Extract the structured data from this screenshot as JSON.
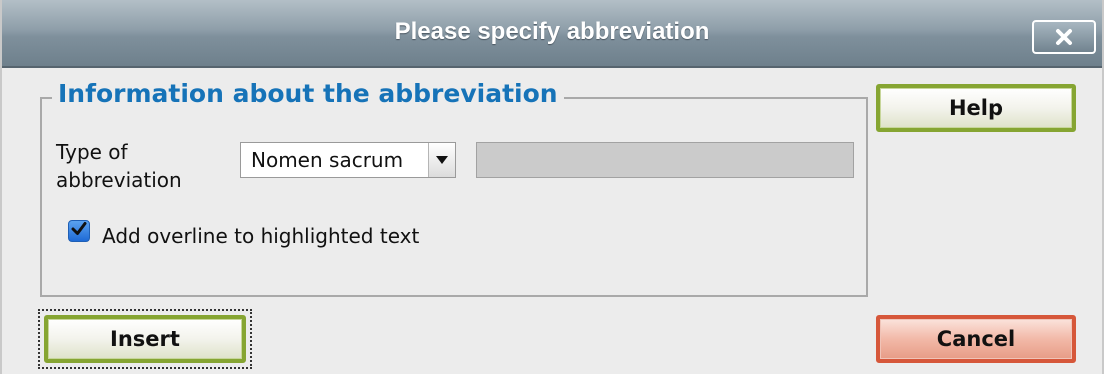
{
  "dialog": {
    "title": "Please specify abbreviation",
    "close_icon": "close-icon"
  },
  "fieldset": {
    "legend": "Information about the abbreviation"
  },
  "type_of_abbreviation": {
    "label": "Type of abbreviation",
    "selected": "Nomen sacrum",
    "text_value": ""
  },
  "overline": {
    "checked": true,
    "label": "Add overline to highlighted text"
  },
  "buttons": {
    "help": "Help",
    "insert": "Insert",
    "cancel": "Cancel"
  },
  "colors": {
    "legend": "#1673b8",
    "titlebar": "#8e9ea9",
    "green_button_border": "#86a532",
    "red_button_border": "#d6573a"
  }
}
